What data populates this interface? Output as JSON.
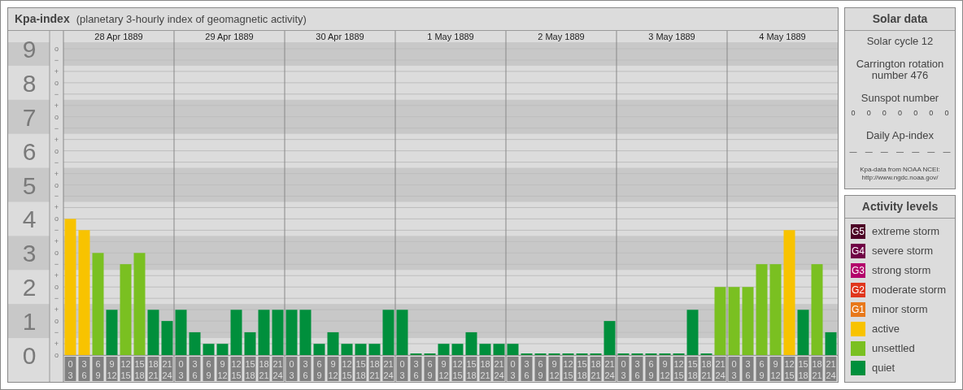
{
  "title": {
    "name": "Kpa-index",
    "subtitle": "(planetary 3-hourly index of geomagnetic activity)"
  },
  "kp_chart": {
    "level_marks": [
      "o",
      "−",
      "+",
      "o",
      "−",
      "+",
      "o",
      "−",
      "+",
      "o",
      "−",
      "+",
      "o",
      "−",
      "+",
      "o",
      "−",
      "+",
      "o",
      "−",
      "+",
      "o",
      "−",
      "+",
      "o",
      "−",
      "+",
      "o"
    ],
    "dates": [
      {
        "date": "28 Apr 1889",
        "slots": [
          [
            "0",
            "3"
          ],
          [
            "3",
            "6"
          ],
          [
            "6",
            "9"
          ],
          [
            "9",
            "12"
          ],
          [
            "12",
            "15"
          ],
          [
            "15",
            "18"
          ],
          [
            "18",
            "21"
          ],
          [
            "21",
            "24"
          ]
        ]
      },
      {
        "date": "29 Apr 1889",
        "slots": [
          [
            "0",
            "3"
          ],
          [
            "3",
            "6"
          ],
          [
            "6",
            "9"
          ],
          [
            "9",
            "12"
          ],
          [
            "12",
            "15"
          ],
          [
            "15",
            "18"
          ],
          [
            "18",
            "21"
          ],
          [
            "21",
            "24"
          ]
        ]
      },
      {
        "date": "30 Apr 1889",
        "slots": [
          [
            "0",
            "3"
          ],
          [
            "3",
            "6"
          ],
          [
            "6",
            "9"
          ],
          [
            "9",
            "12"
          ],
          [
            "12",
            "15"
          ],
          [
            "15",
            "18"
          ],
          [
            "18",
            "21"
          ],
          [
            "21",
            "24"
          ]
        ]
      },
      {
        "date": "1 May 1889",
        "slots": [
          [
            "0",
            "3"
          ],
          [
            "3",
            "6"
          ],
          [
            "6",
            "9"
          ],
          [
            "9",
            "12"
          ],
          [
            "12",
            "15"
          ],
          [
            "15",
            "18"
          ],
          [
            "18",
            "21"
          ],
          [
            "21",
            "24"
          ]
        ]
      },
      {
        "date": "2 May 1889",
        "slots": [
          [
            "0",
            "3"
          ],
          [
            "3",
            "6"
          ],
          [
            "6",
            "9"
          ],
          [
            "9",
            "12"
          ],
          [
            "12",
            "15"
          ],
          [
            "15",
            "18"
          ],
          [
            "18",
            "21"
          ],
          [
            "21",
            "24"
          ]
        ]
      },
      {
        "date": "3 May 1889",
        "slots": [
          [
            "0",
            "3"
          ],
          [
            "3",
            "6"
          ],
          [
            "6",
            "9"
          ],
          [
            "9",
            "12"
          ],
          [
            "12",
            "15"
          ],
          [
            "15",
            "18"
          ],
          [
            "18",
            "21"
          ],
          [
            "21",
            "24"
          ]
        ]
      },
      {
        "date": "4 May 1889",
        "slots": [
          [
            "0",
            "3"
          ],
          [
            "3",
            "6"
          ],
          [
            "6",
            "9"
          ],
          [
            "9",
            "12"
          ],
          [
            "12",
            "15"
          ],
          [
            "15",
            "18"
          ],
          [
            "18",
            "21"
          ],
          [
            "21",
            "24"
          ]
        ]
      }
    ],
    "chart_data": {
      "type": "bar",
      "grid": true,
      "bands": [
        {
          "axis": "y",
          "from": 0.5,
          "to": 1.5
        },
        {
          "axis": "y",
          "from": 2.5,
          "to": 3.5
        },
        {
          "axis": "y",
          "from": 4.5,
          "to": 5.5
        },
        {
          "axis": "y",
          "from": 6.5,
          "to": 7.5
        },
        {
          "axis": "y",
          "from": 8.5,
          "to": 9.19
        }
      ],
      "ylim": [
        0,
        9.19
      ],
      "yticks": [
        0,
        1,
        2,
        3,
        4,
        5,
        6,
        7,
        8,
        9
      ],
      "series": [
        {
          "name": "quiet",
          "color": "#008f3c",
          "values": [
            null,
            null,
            null,
            1.33,
            null,
            null,
            1.33,
            1,
            1.33,
            0.67,
            0.33,
            0.33,
            1.33,
            0.67,
            1.33,
            1.33,
            1.33,
            1.33,
            0.33,
            0.67,
            0.33,
            0.33,
            0.33,
            1.33,
            1.33,
            0,
            0,
            0.33,
            0.33,
            0.67,
            0.33,
            0.33,
            0.33,
            0,
            0,
            0,
            0,
            0,
            0,
            1,
            0,
            0,
            0,
            0,
            0,
            1.33,
            0,
            null,
            null,
            null,
            null,
            null,
            null,
            1.33,
            null,
            0.67
          ]
        },
        {
          "name": "unsettled",
          "color": "#7ac021",
          "values": [
            null,
            null,
            3,
            null,
            2.67,
            3,
            null,
            null,
            null,
            null,
            null,
            null,
            null,
            null,
            null,
            null,
            null,
            null,
            null,
            null,
            null,
            null,
            null,
            null,
            null,
            null,
            null,
            null,
            null,
            null,
            null,
            null,
            null,
            null,
            null,
            null,
            null,
            null,
            null,
            null,
            null,
            null,
            null,
            null,
            null,
            null,
            null,
            2,
            2,
            2,
            2.67,
            2.67,
            null,
            null,
            2.67,
            null
          ]
        },
        {
          "name": "active",
          "color": "#f8c300",
          "values": [
            4,
            3.67,
            null,
            null,
            null,
            null,
            null,
            null,
            null,
            null,
            null,
            null,
            null,
            null,
            null,
            null,
            null,
            null,
            null,
            null,
            null,
            null,
            null,
            null,
            null,
            null,
            null,
            null,
            null,
            null,
            null,
            null,
            null,
            null,
            null,
            null,
            null,
            null,
            null,
            null,
            null,
            null,
            null,
            null,
            null,
            null,
            null,
            null,
            null,
            null,
            null,
            null,
            3.67,
            null,
            null,
            null
          ]
        }
      ]
    }
  },
  "solar_data": {
    "title": "Solar data",
    "cycle": "Solar cycle 12",
    "carrington": "Carrington rotation number 476",
    "sunspot_label": "Sunspot number",
    "sunspot_values": [
      "0",
      "0",
      "0",
      "0",
      "0",
      "0",
      "0"
    ],
    "ap_label": "Daily Ap-index",
    "ap_values": [
      "—",
      "—",
      "—",
      "—",
      "—",
      "—",
      "—"
    ],
    "source": "Kpa-data from NOAA NCEI:",
    "source_url": "http://www.ngdc.noaa.gov/"
  },
  "activity_levels": {
    "title": "Activity levels",
    "storm_items": [
      {
        "badge": "G5",
        "label": "extreme storm",
        "color": "#4d0026"
      },
      {
        "badge": "G4",
        "label": "severe storm",
        "color": "#700045"
      },
      {
        "badge": "G3",
        "label": "strong storm",
        "color": "#b3006b"
      },
      {
        "badge": "G2",
        "label": "moderate storm",
        "color": "#e0361c"
      },
      {
        "badge": "G1",
        "label": "minor storm",
        "color": "#e8781a"
      }
    ]
  }
}
